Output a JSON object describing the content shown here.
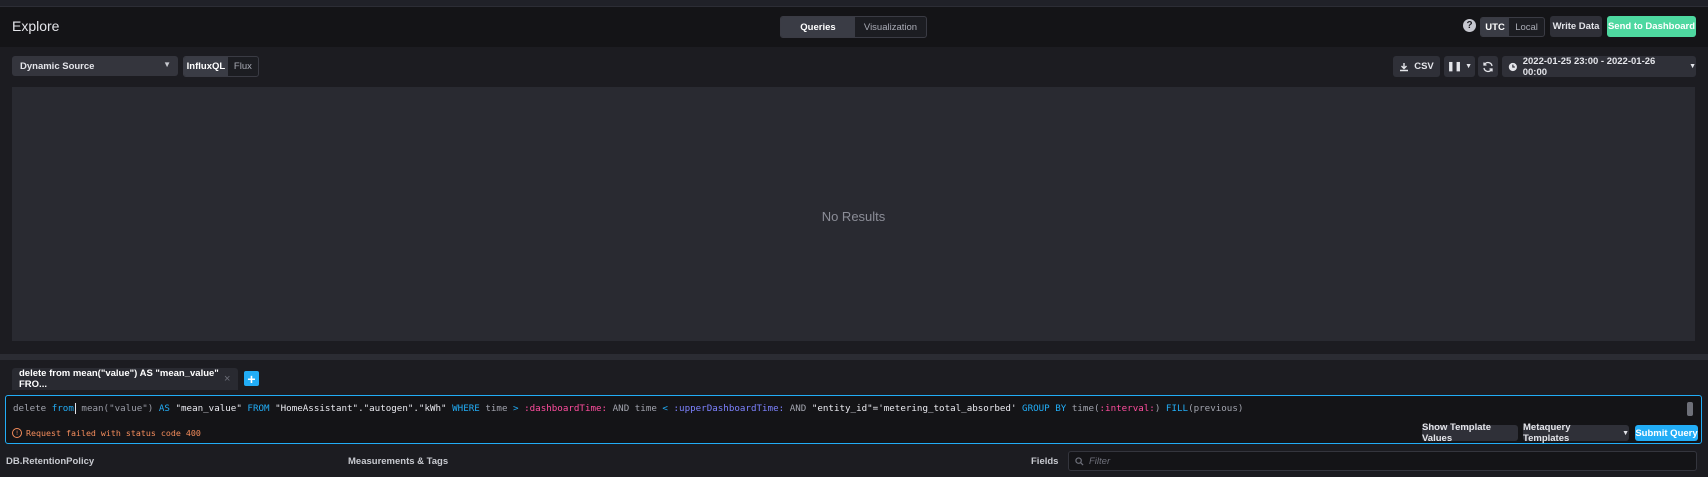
{
  "header": {
    "title": "Explore",
    "tabs": [
      {
        "label": "Queries",
        "active": true
      },
      {
        "label": "Visualization",
        "active": false
      }
    ],
    "help_label": "?",
    "timezone": [
      {
        "label": "UTC",
        "active": true
      },
      {
        "label": "Local",
        "active": false
      }
    ],
    "write_data_label": "Write Data",
    "send_to_dashboard_label": "Send to Dashboard"
  },
  "toolbar": {
    "source_label": "Dynamic Source",
    "lang_tabs": [
      {
        "label": "InfluxQL",
        "active": true
      },
      {
        "label": "Flux",
        "active": false
      }
    ],
    "csv_label": "CSV",
    "time_range_label": "2022-01-25 23:00 - 2022-01-26 00:00"
  },
  "results": {
    "empty_text": "No Results"
  },
  "query_tab": {
    "label": "delete from mean(\"value\") AS \"mean_value\" FRO...",
    "close_label": "×",
    "add_label": "+"
  },
  "editor": {
    "tokens": {
      "t1": "delete ",
      "t2": "from",
      "t3": " mean(\"value\") ",
      "t4": "AS",
      "t5": " ",
      "t6": "\"mean_value\"",
      "t7": " ",
      "t8": "FROM",
      "t9": " ",
      "t10": "\"HomeAssistant\".\"autogen\".\"kWh\"",
      "t11": " ",
      "t12": "WHERE",
      "t13": " time ",
      "t14": ">",
      "t15": " ",
      "t16": ":dashboardTime:",
      "t17": " AND time ",
      "t18": "<",
      "t19": " ",
      "t20": ":upperDashboardTime:",
      "t21": " AND ",
      "t22": "\"entity_id\"='metering_total_absorbed'",
      "t23": " ",
      "t24": "GROUP BY",
      "t25": " time(",
      "t26": ":interval:",
      "t27": ") ",
      "t28": "FILL",
      "t29": "(previous)"
    },
    "error_text": "Request failed with status code 400",
    "show_template_values_label": "Show Template Values",
    "metaquery_templates_label": "Metaquery Templates",
    "submit_query_label": "Submit Query"
  },
  "schema": {
    "db_label": "DB.RetentionPolicy",
    "measurements_label": "Measurements & Tags",
    "fields_label": "Fields",
    "filter_placeholder": "Filter"
  },
  "colors": {
    "accent_blue": "#22adf6",
    "accent_green": "#4ed8a0",
    "error_orange": "#f58d5c",
    "template_var_pink": "#ff4d9e"
  }
}
